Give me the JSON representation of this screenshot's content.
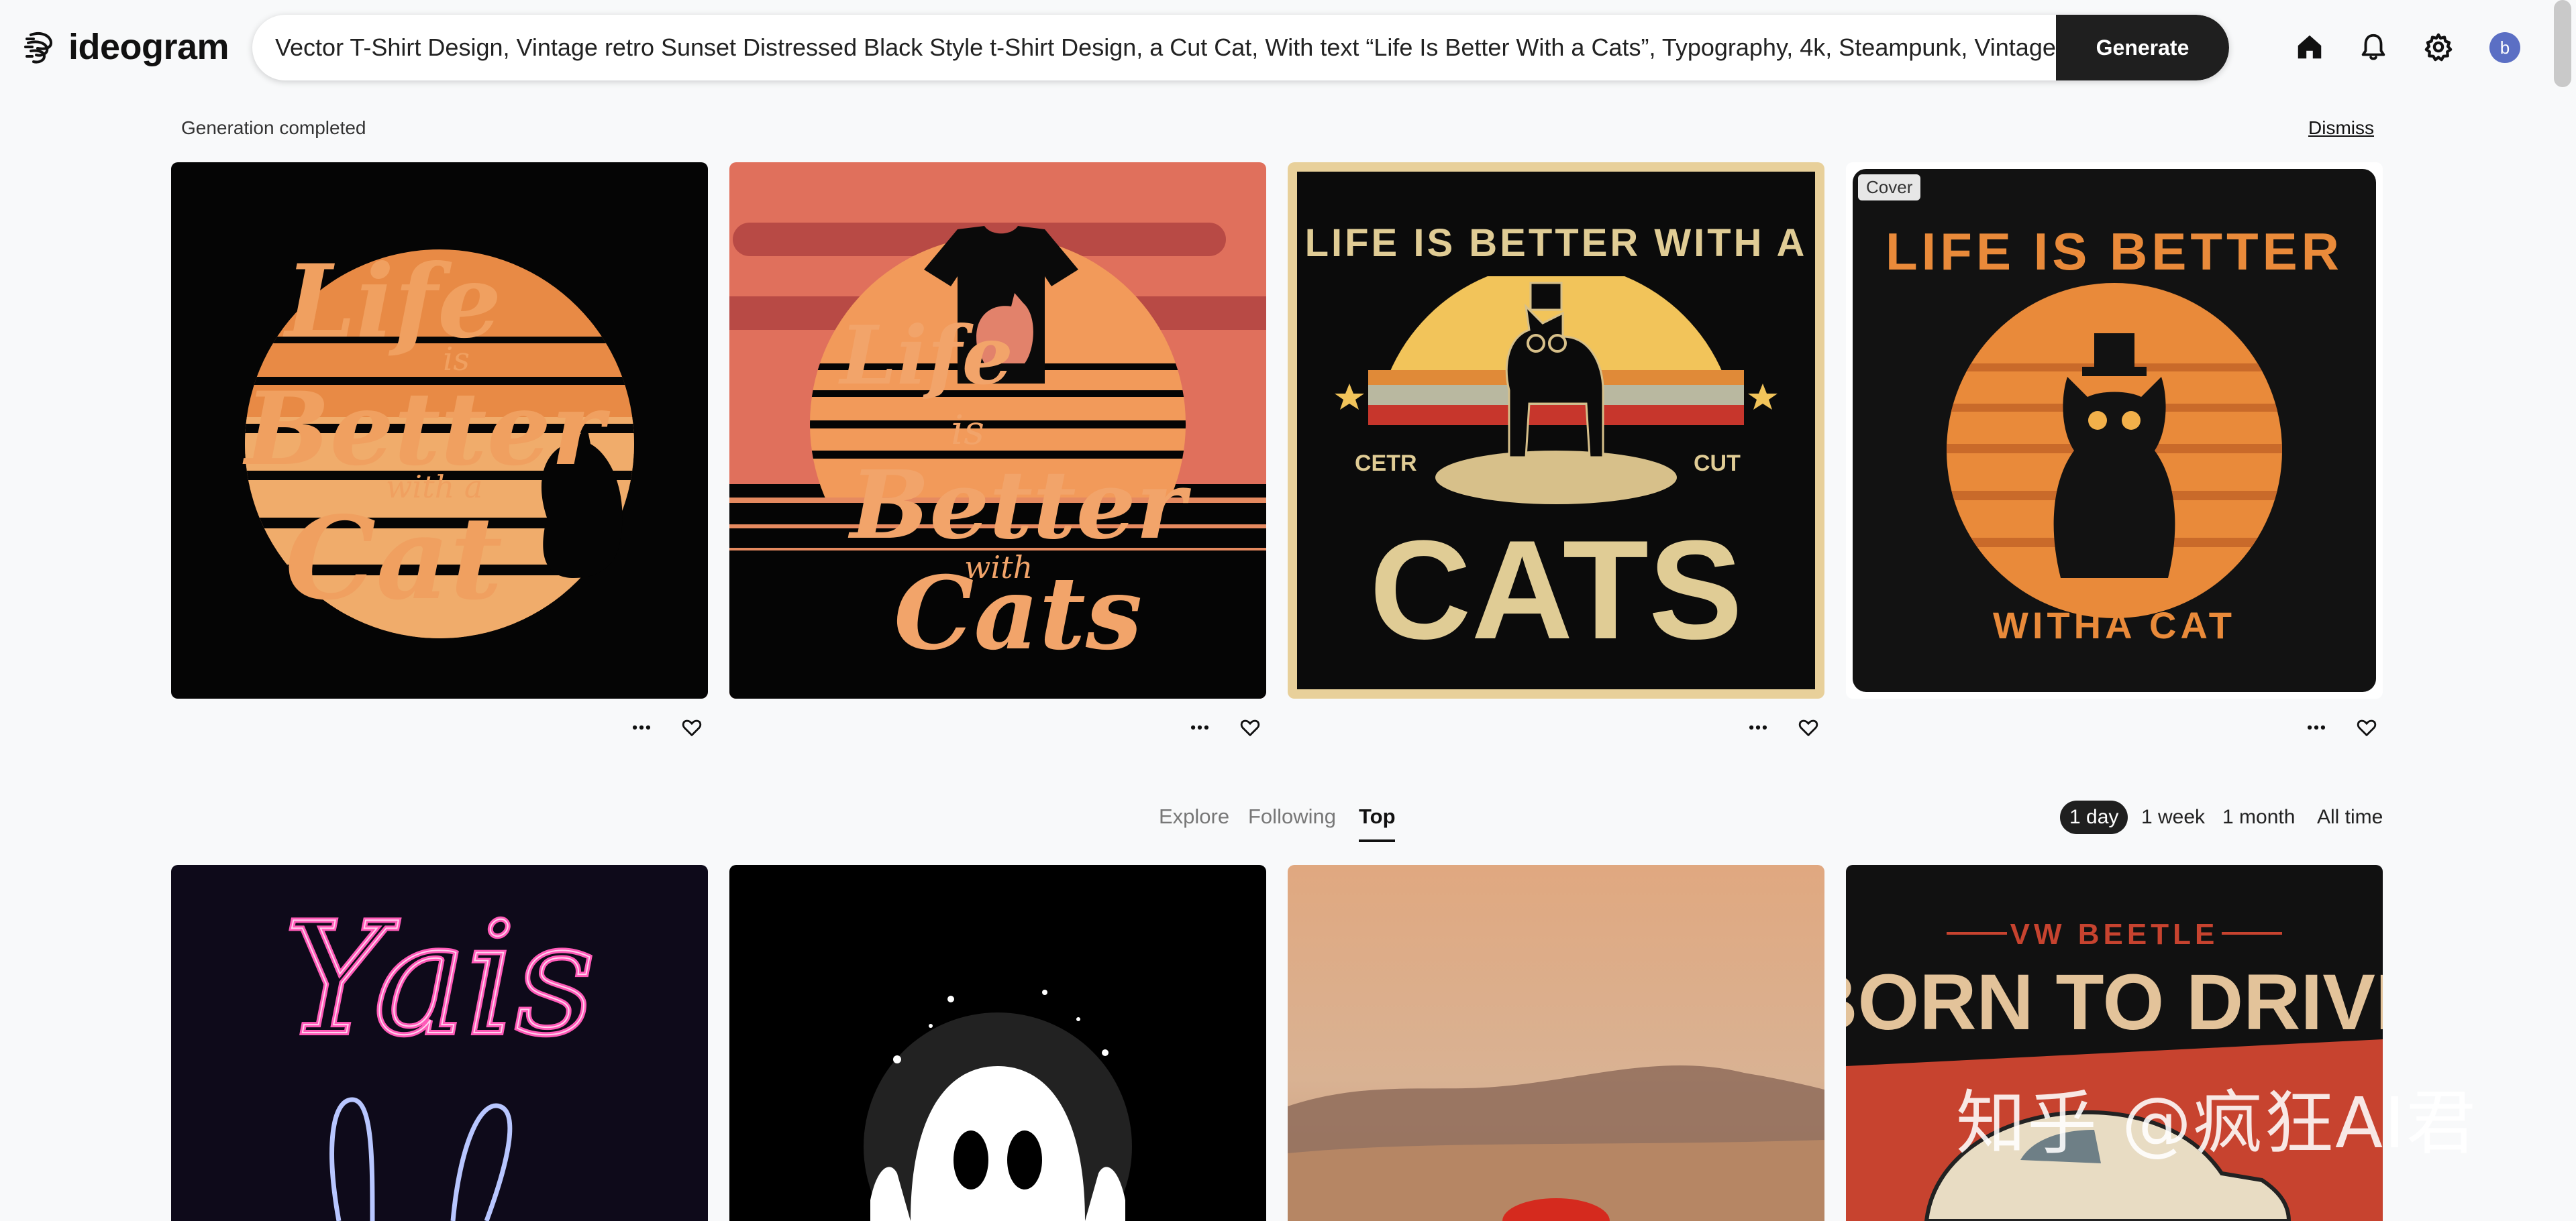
{
  "app": {
    "name": "ideogram"
  },
  "prompt": {
    "text": "Vector T-Shirt Design, Vintage retro Sunset Distressed Black Style t-Shirt Design, a Cut Cat, With text “Life Is Better With a Cats”, Typography, 4k, Steampunk, Vintage,",
    "generate_label": "Generate"
  },
  "header": {
    "avatar_initial": "b"
  },
  "notification": {
    "status": "Generation completed",
    "dismiss_label": "Dismiss"
  },
  "generations": [
    {
      "icon": "sunset-cat-script-artwork",
      "lettering": [
        "Life",
        "is",
        "Better",
        "with a",
        "Cat"
      ]
    },
    {
      "icon": "cat-tshirt-sunset-artwork",
      "lettering": [
        "Life",
        "is",
        "Better",
        "with",
        "Cats"
      ]
    },
    {
      "icon": "steampunk-cat-artwork",
      "lettering": [
        "LIFE IS BETTER WITH A",
        "CETR",
        "CUT",
        "CATS"
      ]
    },
    {
      "icon": "orange-cat-circle-artwork",
      "lettering": [
        "LIFE IS BETTER",
        "WITHA CAT"
      ],
      "badge": "Cover"
    }
  ],
  "feed": {
    "tabs": [
      {
        "label": "Explore",
        "active": false
      },
      {
        "label": "Following",
        "active": false
      },
      {
        "label": "Top",
        "active": true
      }
    ],
    "time_filters": [
      {
        "label": "1 day",
        "active": true
      },
      {
        "label": "1 week",
        "active": false
      },
      {
        "label": "1 month",
        "active": false
      },
      {
        "label": "All time",
        "active": false
      }
    ],
    "items": [
      {
        "icon": "neon-yais-bunny-artwork",
        "lettering": [
          "Yais"
        ]
      },
      {
        "icon": "ghost-splatter-artwork"
      },
      {
        "icon": "desert-mountains-photo"
      },
      {
        "icon": "vw-beetle-poster-artwork",
        "lettering": [
          "VW BEETLE",
          "BORN TO DRIVE"
        ]
      }
    ]
  },
  "watermark": "知乎 @疯狂AI君",
  "colors": {
    "accent_dark": "#1f1f1f",
    "background": "#f8f9fa",
    "avatar": "#5b6fc4"
  }
}
